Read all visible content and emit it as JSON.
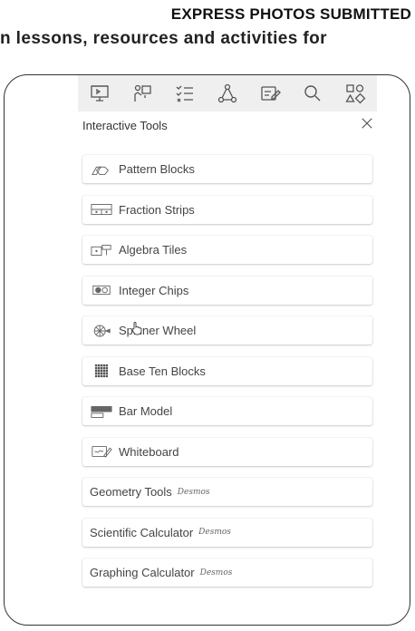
{
  "caption": {
    "headline": "EXPRESS PHOTOS SUBMITTED",
    "subline": "n lessons, resources and activities for"
  },
  "toolbar": {
    "icons": [
      "presentation-icon",
      "teacher-board-icon",
      "checklist-icon",
      "network-icon",
      "edit-note-icon",
      "search-icon",
      "shapes-icon"
    ]
  },
  "panel": {
    "title": "Interactive Tools",
    "close_label": "×"
  },
  "tools": [
    {
      "label": "Pattern Blocks",
      "icon": "pattern-blocks-icon"
    },
    {
      "label": "Fraction Strips",
      "icon": "fraction-strips-icon"
    },
    {
      "label": "Algebra Tiles",
      "icon": "algebra-tiles-icon"
    },
    {
      "label": "Integer Chips",
      "icon": "integer-chips-icon"
    },
    {
      "label": "Spinner Wheel",
      "icon": "spinner-wheel-icon"
    },
    {
      "label": "Base Ten Blocks",
      "icon": "base-ten-blocks-icon"
    },
    {
      "label": "Bar Model",
      "icon": "bar-model-icon"
    },
    {
      "label": "Whiteboard",
      "icon": "whiteboard-icon"
    },
    {
      "label": "Geometry Tools",
      "suffix": "Desmos"
    },
    {
      "label": "Scientific Calculator",
      "suffix": "Desmos"
    },
    {
      "label": "Graphing Calculator",
      "suffix": "Desmos"
    }
  ],
  "colors": {
    "toolbar_bg": "#efefef",
    "text": "#444444",
    "frame": "#333333"
  }
}
